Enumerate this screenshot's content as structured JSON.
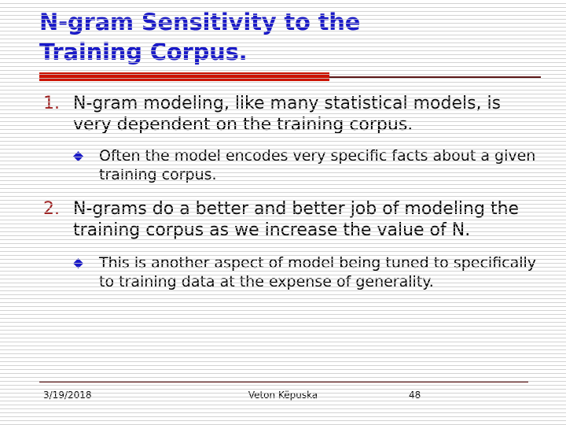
{
  "slide": {
    "title_lines": [
      "N-gram Sensitivity to the",
      "Training Corpus."
    ],
    "title_color": "#1a1ac8",
    "rule_thick_color": "#cc1100",
    "rule_thin_color": "#5c1717",
    "background_color": "#ffffff"
  },
  "content": {
    "items": [
      {
        "marker": "1.",
        "marker_color": "#9e2020",
        "text": "N-gram modeling, like many statistical models, is very dependent on the training corpus.",
        "subs": [
          {
            "bullet": "diamond-bullet",
            "glyph": "◆",
            "text": "Often the model encodes very specific facts about a given training corpus."
          }
        ]
      },
      {
        "marker": "2.",
        "marker_color": "#9e2020",
        "text": "N-grams do a better and better job of modeling the training corpus as we increase the value of N.",
        "subs": [
          {
            "bullet": "diamond-bullet",
            "glyph": "◆",
            "text": "This is another aspect of model being tuned to specifically to training data at the expense of generality."
          }
        ]
      }
    ]
  },
  "footer": {
    "date": "3/19/2018",
    "author": "Veton Këpuska",
    "page_number": "48"
  }
}
